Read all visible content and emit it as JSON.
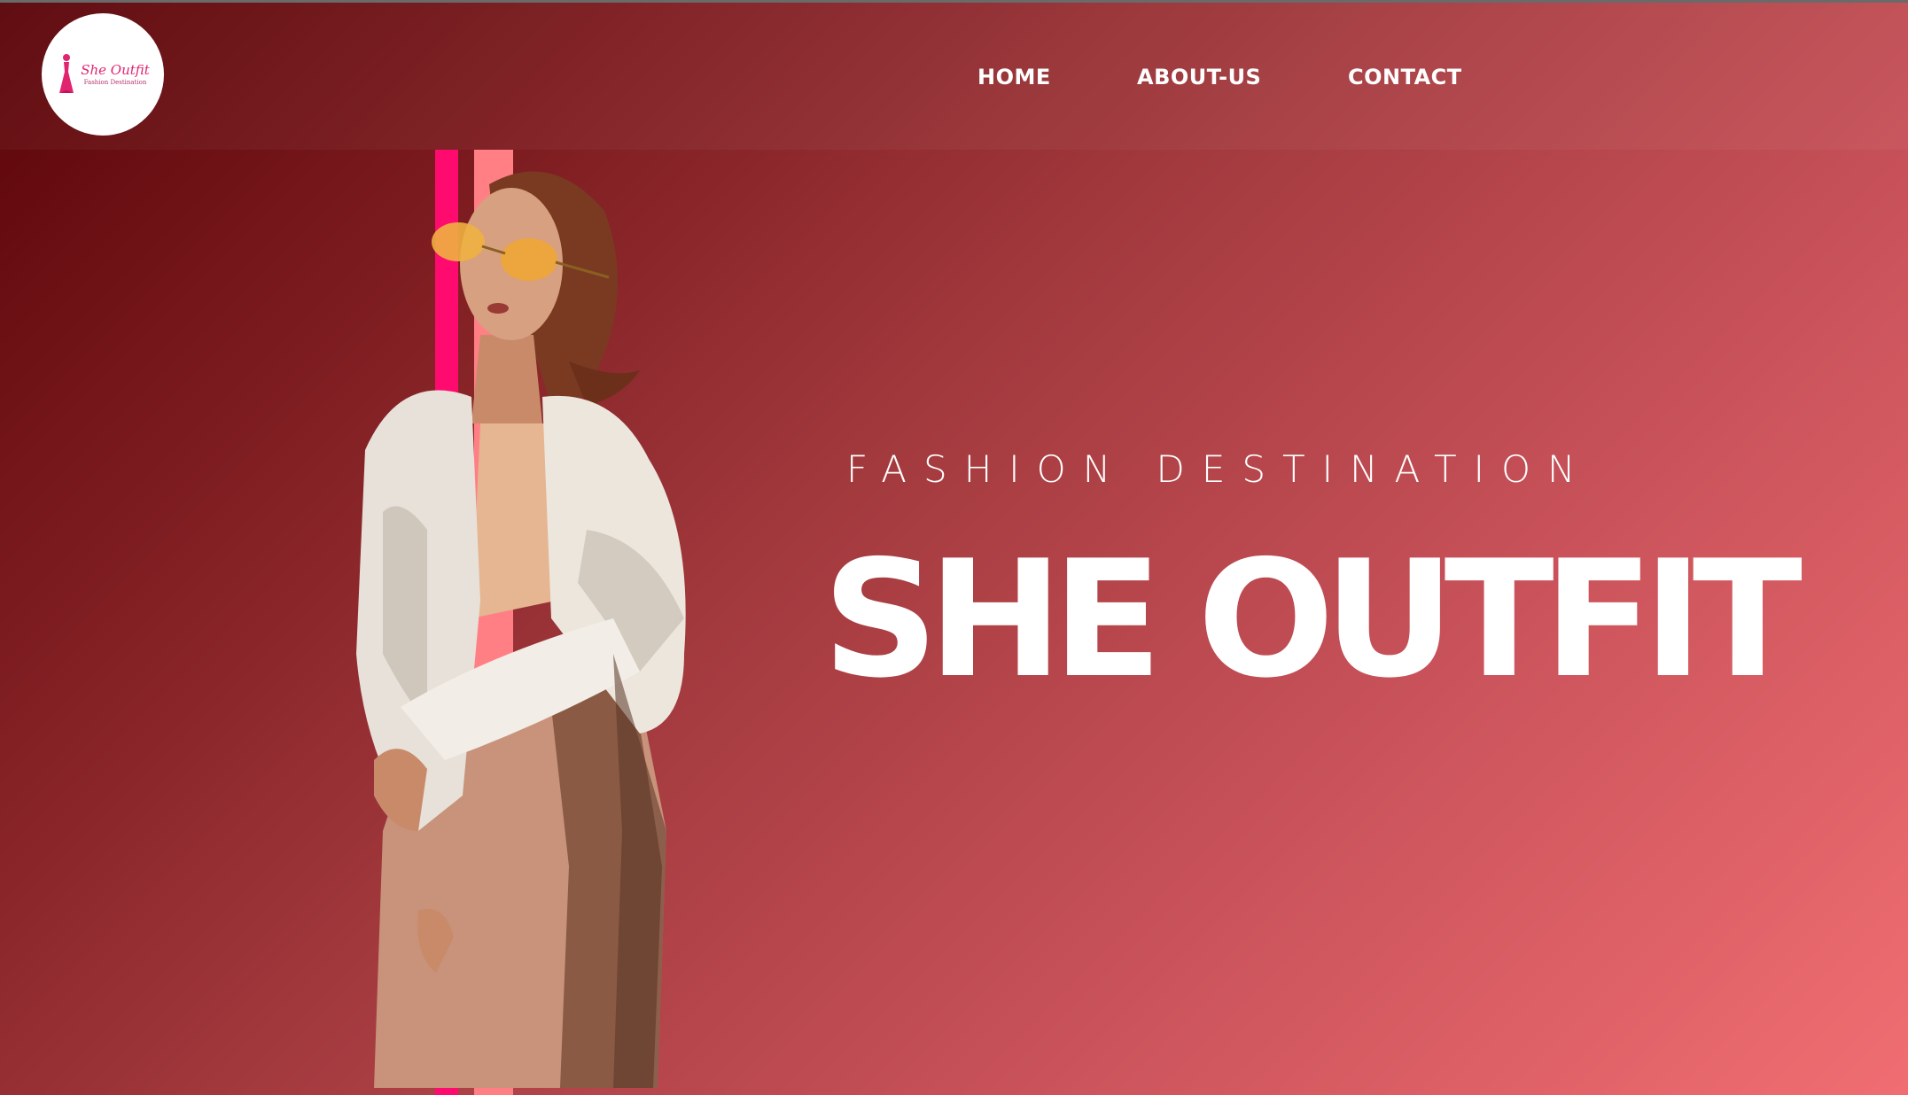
{
  "brand": {
    "logo_title": "She Outfit",
    "logo_subtitle": "Fashion Destination"
  },
  "nav": {
    "items": [
      "HOME",
      "ABOUT-US",
      "CONTACT"
    ]
  },
  "hero": {
    "subtitle": "FASHION DESTINATION",
    "title": "SHE OUTFIT"
  },
  "colors": {
    "gradient_start": "#5a0408",
    "gradient_end": "#f06e72",
    "stripe_hot_pink": "#ff0a6e",
    "stripe_salmon": "#ff7f84",
    "logo_pink": "#e2236f",
    "text": "#ffffff"
  }
}
